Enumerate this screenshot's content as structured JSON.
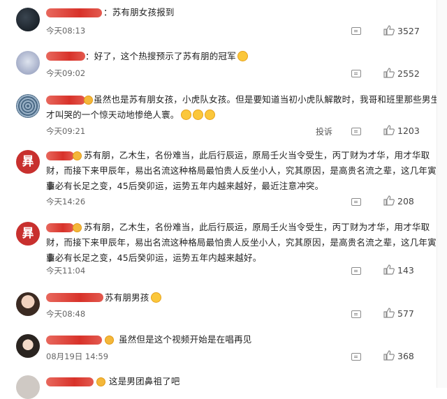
{
  "comments": [
    {
      "text": "苏有朋女孩报到",
      "time": "今天08:13",
      "likes": "3527"
    },
    {
      "text": "好了，这个热搜预示了苏有朋的冠军",
      "time": "今天09:02",
      "likes": "2552"
    },
    {
      "text_line1": "虽然也是苏有朋女孩，小虎队女孩。但是要知道当初小虎队解散时，我哥和班里那些男生",
      "text_line2": "才叫哭的一个惊天动地惨绝人寰。",
      "time": "今天09:21",
      "report": "投诉",
      "likes": "1203"
    },
    {
      "text_line1": "苏有朋，乙木生，名份难当，此后行辰运，原局壬火当令受生，丙丁财为才华，用才华取",
      "text_line2": "财，而接下来甲辰年，易出名流这种格局最怕贵人反坐小人，究其原因，是高贵名流之辈，这几年寅年事",
      "text_line3": "业必有长足之变，45后癸卯运，运势五年内越来越好，最近注意冲突。",
      "time": "今天14:26",
      "likes": "208",
      "avatar_char": "昪"
    },
    {
      "text_line1": "苏有朋，乙木生，名份难当，此后行辰运，原局壬火当令受生，丙丁财为才华，用才华取",
      "text_line2": "财，而接下来甲辰年，易出名流这种格局最怕贵人反坐小人，究其原因，是高贵名流之辈，这几年寅年事",
      "text_line3": "业必有长足之变，45后癸卯运，运势五年内越来越好。",
      "time": "今天11:04",
      "likes": "143",
      "avatar_char": "昪"
    },
    {
      "text": "苏有朋男孩",
      "time": "今天08:48",
      "likes": "577"
    },
    {
      "text": "虽然但是这个视频开始是在唱再见",
      "time": "08月19日 14:59",
      "likes": "368"
    },
    {
      "text": "这是男团鼻祖了吧",
      "time": "",
      "likes": ""
    }
  ]
}
